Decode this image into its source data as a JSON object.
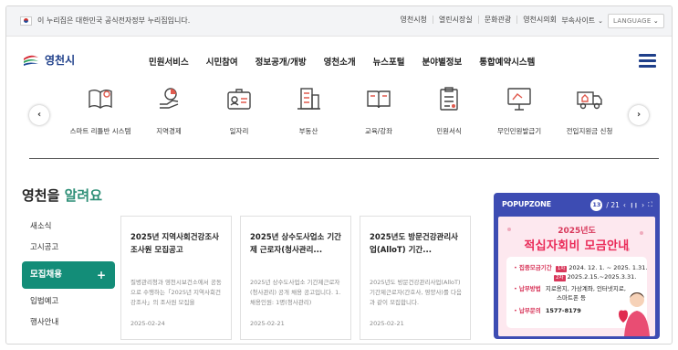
{
  "gov_bar": {
    "notice": "이 누리집은 대한민국 공식전자정부 누리집입니다.",
    "links": [
      "영천시청",
      "열린시장실",
      "문화관광",
      "영천시의회"
    ],
    "affiliated_sites": "부속사이트",
    "language": "LANGUAGE"
  },
  "header": {
    "logo_text": "영천시",
    "menu": [
      "민원서비스",
      "시민참여",
      "정보공개/개방",
      "영천소개",
      "뉴스포털",
      "분야별정보",
      "통합예약시스템"
    ]
  },
  "quick_menu": {
    "prev": "‹",
    "next": "›",
    "items": [
      {
        "label": "스마트 리틀반 시스템",
        "icon": "book-icon"
      },
      {
        "label": "지역경제",
        "icon": "chart-hand-icon"
      },
      {
        "label": "일자리",
        "icon": "id-badge-icon"
      },
      {
        "label": "부동산",
        "icon": "building-icon"
      },
      {
        "label": "교육/강좌",
        "icon": "open-book-icon"
      },
      {
        "label": "민원서식",
        "icon": "clipboard-icon"
      },
      {
        "label": "무인민원발급기",
        "icon": "kiosk-icon"
      },
      {
        "label": "전입지원금 신청",
        "icon": "moving-truck-icon"
      }
    ]
  },
  "promo": {
    "title_prefix": "영천을 ",
    "title_highlight": "알려요",
    "categories": [
      "새소식",
      "고시공고",
      "모집채용",
      "입법예고",
      "행사안내"
    ],
    "active_category_plus": "+",
    "cards": [
      {
        "title": "2025년 지역사회건강조사 조사원 모집공고",
        "desc": "질병관리청과 영천시보건소에서 공동으로 수행하는「2025년 지역사회건강조사」의 조사원 모집을",
        "date": "2025-02-24"
      },
      {
        "title": "2025년 상수도사업소 기간제 근로자(청사관리...",
        "desc": "2025년 상수도사업소 기간제근로자(청사관리) 공개 채용 공고입니다. 1. 채용인원: 1명(청사관리)",
        "date": "2025-02-21"
      },
      {
        "title": "2025년도 방문건강관리사업(AlloT) 기간...",
        "desc": "2025년도 방문건강관리사업(AlloT) 기간제근로자(간호사, 영양사)를 다음과 같이 모집합니다.",
        "date": "2025-02-21"
      }
    ]
  },
  "popup_zone": {
    "title": "POPUPZONE",
    "current": "13",
    "total": "/ 21",
    "prev": "‹",
    "pause": "❙❙",
    "next": "›",
    "expand": "⛶",
    "banner": {
      "line1": "2025년도",
      "line2": "적십자회비 모금안내",
      "period_label": "집중모금기간",
      "period_1_year": "1차",
      "period_1": "2024. 12. 1. ~ 2025. 1.31.",
      "period_2_year": "2차",
      "period_2": "2025.2.15.~2025.3.31.",
      "method_label": "납부방법",
      "method": "지로용지, 가상계좌, 인터넷지로,",
      "method_2": "스마트폰 등",
      "contact_label": "납부문의",
      "contact": "1577-8179"
    }
  }
}
